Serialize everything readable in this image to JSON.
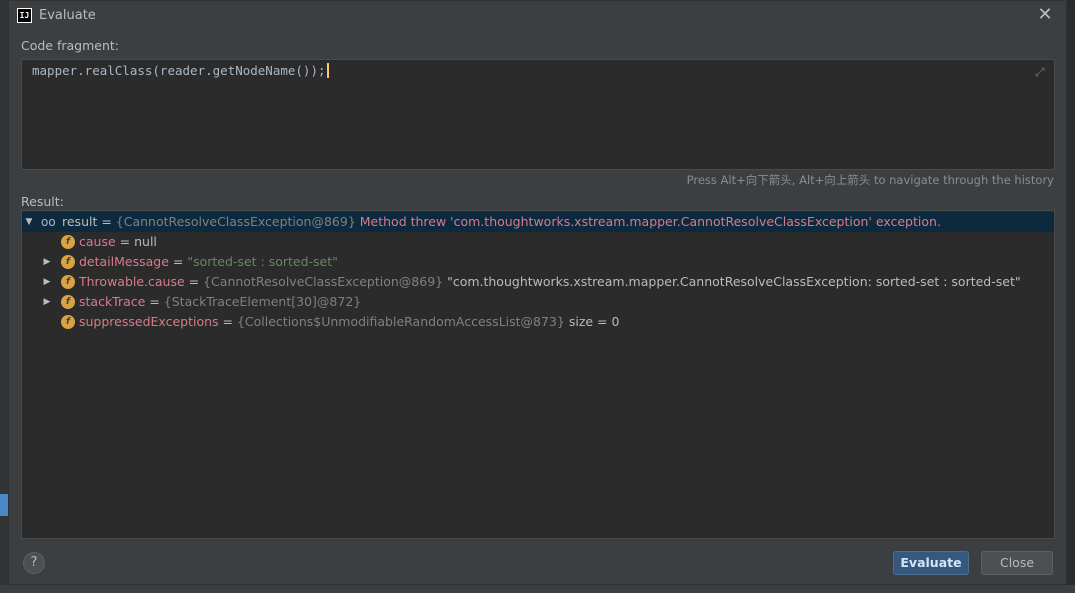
{
  "window": {
    "title": "Evaluate",
    "app_icon_text": "IJ"
  },
  "code_fragment": {
    "label": "Code fragment:",
    "value": "mapper.realClass(reader.getNodeName());"
  },
  "history_hint": "Press Alt+向下箭头, Alt+向上箭头 to navigate through the history",
  "result": {
    "label": "Result:",
    "root": {
      "name": "result",
      "eq": " = ",
      "value": "{CannotResolveClassException@869}",
      "message": " Method threw 'com.thoughtworks.xstream.mapper.CannotResolveClassException' exception."
    },
    "children": [
      {
        "badge": "f",
        "expandable": false,
        "name": "cause",
        "eq": " = ",
        "value": "null",
        "value_style": "plain",
        "extra": ""
      },
      {
        "badge": "f",
        "expandable": true,
        "name": "detailMessage",
        "eq": " = ",
        "value": "\"sorted-set : sorted-set\"",
        "value_style": "green",
        "extra": ""
      },
      {
        "badge": "f",
        "expandable": true,
        "name": "Throwable.cause",
        "eq": " = ",
        "value": "{CannotResolveClassException@869}",
        "value_style": "gray",
        "extra": " \"com.thoughtworks.xstream.mapper.CannotResolveClassException: sorted-set : sorted-set\""
      },
      {
        "badge": "f",
        "expandable": true,
        "name": "stackTrace",
        "eq": " = ",
        "value": "{StackTraceElement[30]@872}",
        "value_style": "gray",
        "extra": ""
      },
      {
        "badge": "f",
        "expandable": false,
        "name": "suppressedExceptions",
        "eq": " = ",
        "value": "{Collections$UnmodifiableRandomAccessList@873}",
        "value_style": "gray",
        "extra": "  size = 0"
      }
    ]
  },
  "buttons": {
    "help": "?",
    "evaluate": "Evaluate",
    "close": "Close"
  },
  "colors": {
    "accent": "#365880",
    "error_text": "#d77b8b",
    "field_badge": "#d9a343",
    "string_value": "#6a8759"
  }
}
